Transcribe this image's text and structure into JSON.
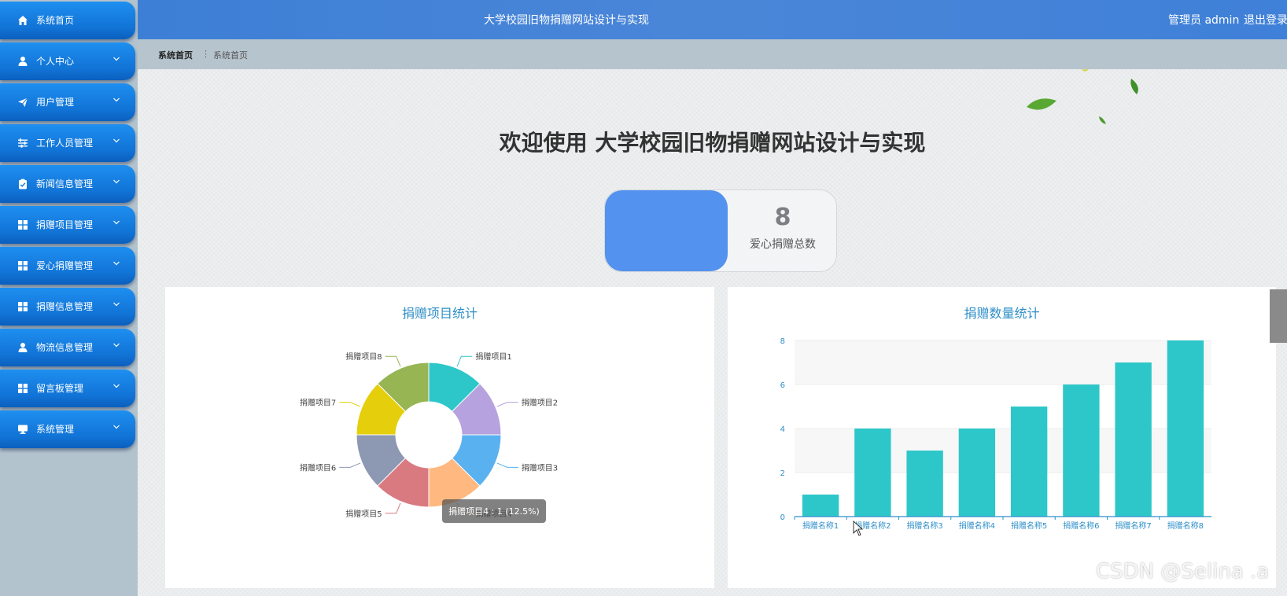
{
  "header": {
    "title": "大学校园旧物捐赠网站设计与实现",
    "user": "管理员 admin",
    "logout": "退出登录"
  },
  "sidebar": {
    "items": [
      {
        "label": "系统首页",
        "icon": "home-icon",
        "has_chevron": false
      },
      {
        "label": "个人中心",
        "icon": "person-icon",
        "has_chevron": true
      },
      {
        "label": "用户管理",
        "icon": "send-icon",
        "has_chevron": true
      },
      {
        "label": "工作人员管理",
        "icon": "sliders-icon",
        "has_chevron": true
      },
      {
        "label": "新闻信息管理",
        "icon": "clipboard-icon",
        "has_chevron": true
      },
      {
        "label": "捐赠项目管理",
        "icon": "grid-icon",
        "has_chevron": true
      },
      {
        "label": "爱心捐赠管理",
        "icon": "grid-icon",
        "has_chevron": true
      },
      {
        "label": "捐赠信息管理",
        "icon": "grid-icon",
        "has_chevron": true
      },
      {
        "label": "物流信息管理",
        "icon": "person-icon",
        "has_chevron": true
      },
      {
        "label": "留言板管理",
        "icon": "grid-icon",
        "has_chevron": true
      },
      {
        "label": "系统管理",
        "icon": "monitor-icon",
        "has_chevron": true
      }
    ]
  },
  "breadcrumb": {
    "first": "系统首页",
    "separator": "⋮",
    "current": "系统首页"
  },
  "main": {
    "welcome": "欢迎使用 大学校园旧物捐赠网站设计与实现",
    "stat": {
      "value": "8",
      "label": "爱心捐赠总数"
    },
    "pie_title": "捐赠项目统计",
    "bar_title": "捐赠数量统计"
  },
  "watermark": "CSDN @Selina .a",
  "colors": {
    "menu_blue": "#1173d6",
    "header_blue": "#3d7fd6",
    "stat_blue": "#5392ee",
    "bar_teal": "#2ec7c9",
    "title_blue": "#2f8fc8"
  },
  "chart_data": [
    {
      "type": "pie",
      "title": "捐赠项目统计",
      "categories": [
        "捐赠项目1",
        "捐赠项目2",
        "捐赠项目3",
        "捐赠项目4",
        "捐赠项目5",
        "捐赠项目6",
        "捐赠项目7",
        "捐赠项目8"
      ],
      "values": [
        1,
        1,
        1,
        1,
        1,
        1,
        1,
        1
      ],
      "colors": [
        "#2ec7c9",
        "#b6a2de",
        "#5ab1ef",
        "#ffb980",
        "#d87a80",
        "#8d98b3",
        "#e5cf0d",
        "#97b552"
      ],
      "tooltip": "捐赠项目4 : 1 (12.5%)"
    },
    {
      "type": "bar",
      "title": "捐赠数量统计",
      "categories": [
        "捐赠名称1",
        "捐赠名称2",
        "捐赠名称3",
        "捐赠名称4",
        "捐赠名称5",
        "捐赠名称6",
        "捐赠名称7",
        "捐赠名称8"
      ],
      "values": [
        1,
        4,
        3,
        4,
        5,
        6,
        7,
        8
      ],
      "ylim": [
        0,
        8
      ],
      "yticks": [
        0,
        2,
        4,
        6,
        8
      ],
      "grid": true
    }
  ]
}
